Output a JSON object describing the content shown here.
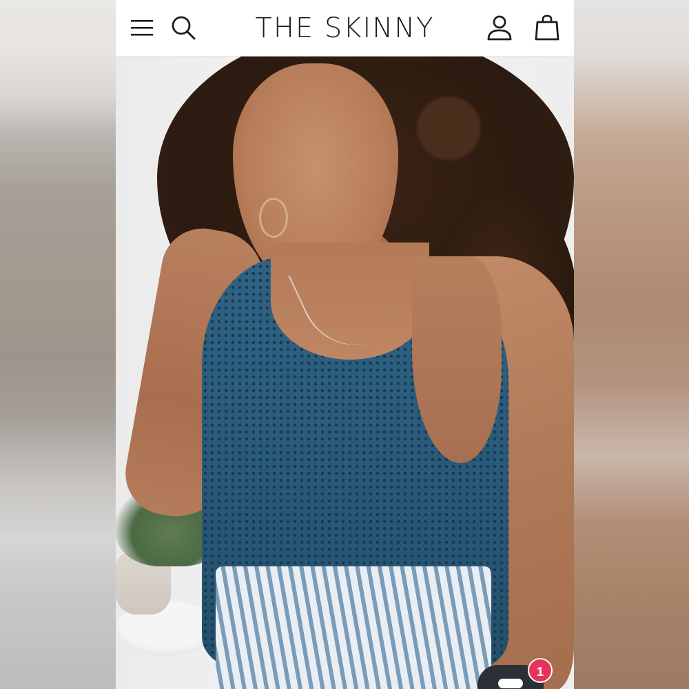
{
  "header": {
    "logo_text": "THE SKINNY",
    "menu_icon": "hamburger-menu-icon",
    "search_icon": "search-icon",
    "account_icon": "user-icon",
    "cart_icon": "shopping-bag-icon"
  },
  "chat": {
    "icon": "chat-icon",
    "badge_count": "1",
    "badge_color": "#e8325a"
  },
  "colors": {
    "text": "#1c1c1c",
    "header_bg": "#ffffff",
    "top_color": "#2a5a7a"
  }
}
